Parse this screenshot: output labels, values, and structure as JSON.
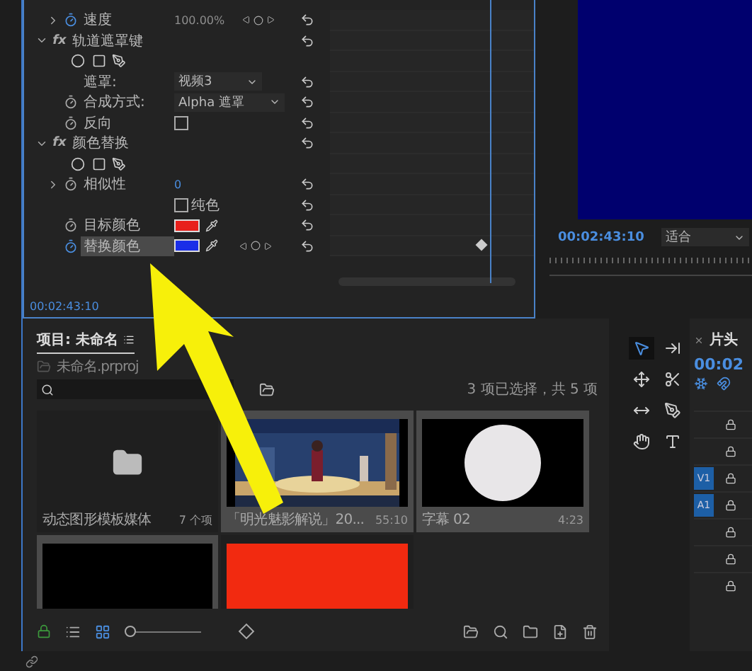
{
  "effect_controls": {
    "rows": [
      {
        "kind": "param",
        "label": "速度",
        "value": "100.00%",
        "expanded": false,
        "stopwatch_on": true,
        "keyframe_nav": true,
        "selected": false
      },
      {
        "kind": "section",
        "badge": "fx",
        "label": "轨道遮罩键",
        "expanded": true,
        "selected": false
      },
      {
        "kind": "mask_tools"
      },
      {
        "kind": "dropdown",
        "label": "遮罩:",
        "value": "视频3",
        "selected": false
      },
      {
        "kind": "dropdown",
        "label": "合成方式:",
        "value": "Alpha 遮罩",
        "stopwatch_on": false,
        "selected": false
      },
      {
        "kind": "checkbox",
        "label": "反向",
        "checked": false,
        "stopwatch_on": false,
        "selected": false
      },
      {
        "kind": "section",
        "badge": "fx",
        "label": "颜色替换",
        "expanded": true,
        "selected": false
      },
      {
        "kind": "mask_tools"
      },
      {
        "kind": "param",
        "label": "相似性",
        "value": "0",
        "expanded": false,
        "stopwatch_on": false,
        "selected": false
      },
      {
        "kind": "checkbox_after",
        "label": "纯色",
        "checked": false,
        "selected": false
      },
      {
        "kind": "color",
        "label": "目标颜色",
        "color": "#e8201c",
        "stopwatch_on": false,
        "selected": false
      },
      {
        "kind": "color",
        "label": "替换颜色",
        "color": "#1a2ee8",
        "stopwatch_on": true,
        "keyframe_nav": true,
        "keyframe": true,
        "selected": true
      }
    ],
    "timecode": "00:02:43:10"
  },
  "program_monitor": {
    "timecode": "00:02:43:10",
    "zoom": "适合"
  },
  "project": {
    "tab": "项目: 未命名",
    "file": "未命名.prproj",
    "count": "3 项已选择，共 5 项",
    "zoom_slider": {
      "level": 0
    },
    "items": [
      {
        "kind": "bin",
        "name": "动态图形模板媒体",
        "info": "7 个项",
        "selected": false
      },
      {
        "kind": "picture",
        "name": "「明光魅影解说」20...",
        "info": "55:10",
        "selected": true
      },
      {
        "kind": "circle",
        "name": "字幕 02",
        "info": "4:23",
        "selected": true
      },
      {
        "kind": "black",
        "selected": true
      },
      {
        "kind": "red",
        "selected": false
      }
    ]
  },
  "tools": [
    {
      "kind": "selection",
      "selected": true
    },
    {
      "kind": "track_select",
      "selected": false
    },
    {
      "kind": "ripple",
      "selected": false
    },
    {
      "kind": "razor",
      "selected": false
    },
    {
      "kind": "slip",
      "selected": false
    },
    {
      "kind": "pen",
      "selected": false
    },
    {
      "kind": "hand",
      "selected": false
    },
    {
      "kind": "type",
      "selected": false
    }
  ],
  "timeline": {
    "title": "片头",
    "timecode": "00:02",
    "tracks": [
      {
        "kind": "plain"
      },
      {
        "kind": "plain"
      },
      {
        "kind": "labeled",
        "label": "V1"
      },
      {
        "kind": "labeled",
        "label": "A1"
      },
      {
        "kind": "plain"
      },
      {
        "kind": "plain"
      },
      {
        "kind": "plain"
      }
    ]
  }
}
